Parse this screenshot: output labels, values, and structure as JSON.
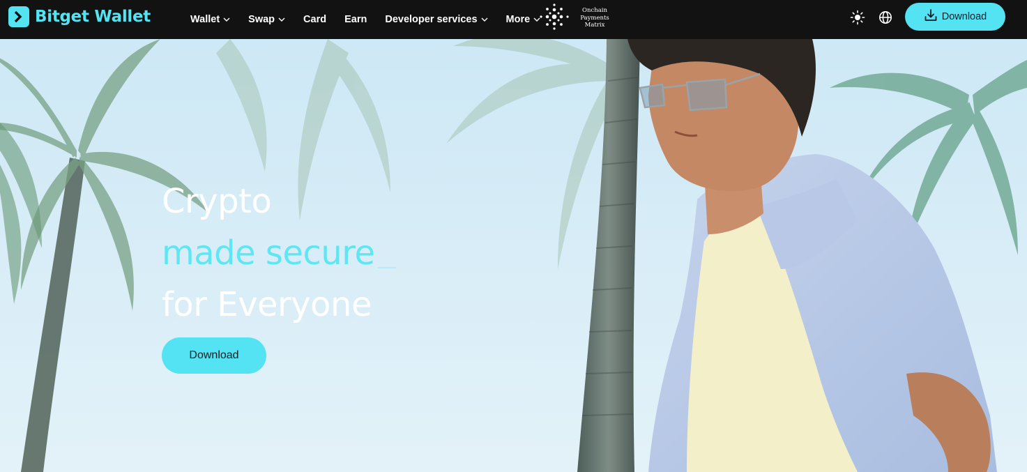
{
  "brand": {
    "name": "Bitget Wallet",
    "accent": "#54E3F2"
  },
  "nav": {
    "items": [
      {
        "label": "Wallet",
        "dropdown": true
      },
      {
        "label": "Swap",
        "dropdown": true
      },
      {
        "label": "Card",
        "dropdown": false
      },
      {
        "label": "Earn",
        "dropdown": false
      },
      {
        "label": "Developer services",
        "dropdown": true
      },
      {
        "label": "More",
        "dropdown": true
      }
    ]
  },
  "partner": {
    "line1": "Onchain",
    "line2": "Payments",
    "line3": "Matrix",
    "icon": "dot-matrix-logo-icon"
  },
  "header_actions": {
    "theme_icon": "sun-icon",
    "language_icon": "globe-icon",
    "download_label": "Download",
    "download_icon": "download-icon"
  },
  "hero": {
    "line1": "Crypto",
    "line2": "made secure",
    "line3": "for Everyone",
    "cta_label": "Download",
    "colors": {
      "white": "#ffffff",
      "cyan": "#5ee6f3",
      "button": "#54E3F2"
    }
  }
}
